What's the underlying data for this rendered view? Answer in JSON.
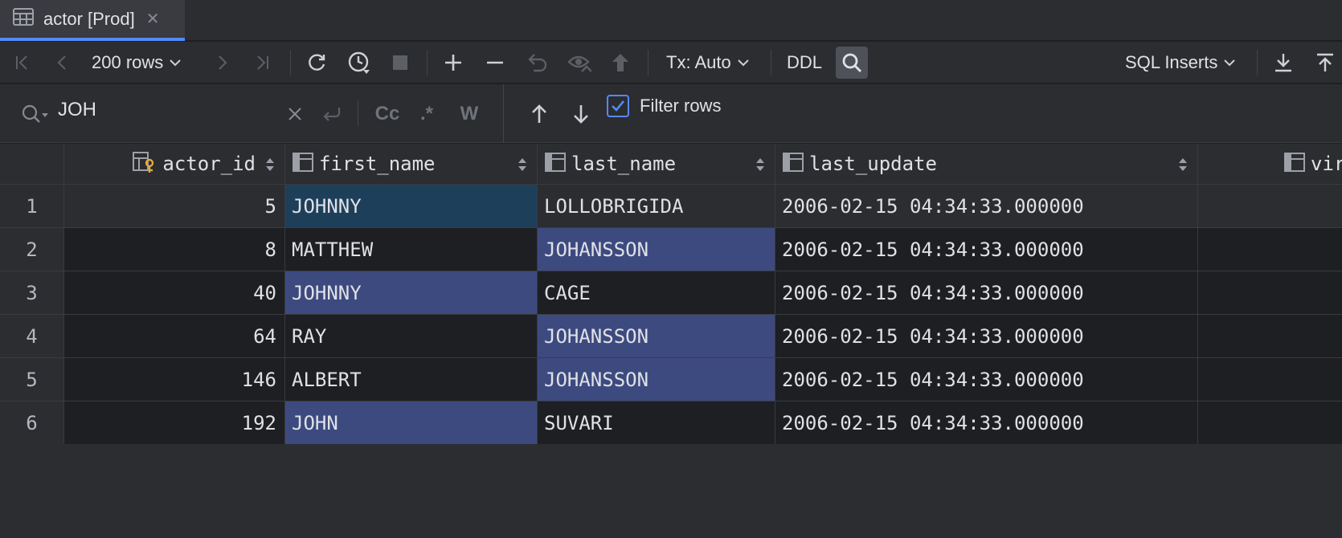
{
  "tab": {
    "label": "actor [Prod]",
    "icon": "table-icon"
  },
  "toolbar": {
    "rows_label": "200 rows",
    "tx_label": "Tx: Auto",
    "ddl_label": "DDL",
    "export_label": "SQL Inserts"
  },
  "find": {
    "query": "JOH",
    "match_case_label": "Cc",
    "regex_label": ".*",
    "words_label": "W",
    "filter_rows_label": "Filter rows",
    "filter_rows_checked": true
  },
  "grid": {
    "columns": [
      {
        "name": "actor_id",
        "icon": "primary-key-column-icon"
      },
      {
        "name": "first_name",
        "icon": "column-icon"
      },
      {
        "name": "last_name",
        "icon": "column-icon"
      },
      {
        "name": "last_update",
        "icon": "column-icon"
      },
      {
        "name": "vir",
        "icon": "column-icon"
      }
    ],
    "rows": [
      {
        "n": "1",
        "actor_id": "5",
        "first_name": "JOHNNY",
        "last_name": "LOLLOBRIGIDA",
        "last_update": "2006-02-15 04:34:33.000000"
      },
      {
        "n": "2",
        "actor_id": "8",
        "first_name": "MATTHEW",
        "last_name": "JOHANSSON",
        "last_update": "2006-02-15 04:34:33.000000"
      },
      {
        "n": "3",
        "actor_id": "40",
        "first_name": "JOHNNY",
        "last_name": "CAGE",
        "last_update": "2006-02-15 04:34:33.000000"
      },
      {
        "n": "4",
        "actor_id": "64",
        "first_name": "RAY",
        "last_name": "JOHANSSON",
        "last_update": "2006-02-15 04:34:33.000000"
      },
      {
        "n": "5",
        "actor_id": "146",
        "first_name": "ALBERT",
        "last_name": "JOHANSSON",
        "last_update": "2006-02-15 04:34:33.000000"
      },
      {
        "n": "6",
        "actor_id": "192",
        "first_name": "JOHN",
        "last_name": "SUVARI",
        "last_update": "2006-02-15 04:34:33.000000"
      }
    ]
  },
  "colors": {
    "accent": "#548af7",
    "match_highlight": "#3d4a7f",
    "current_match": "#1e3f5a",
    "background": "#1e1f22",
    "panel": "#2b2d30"
  }
}
